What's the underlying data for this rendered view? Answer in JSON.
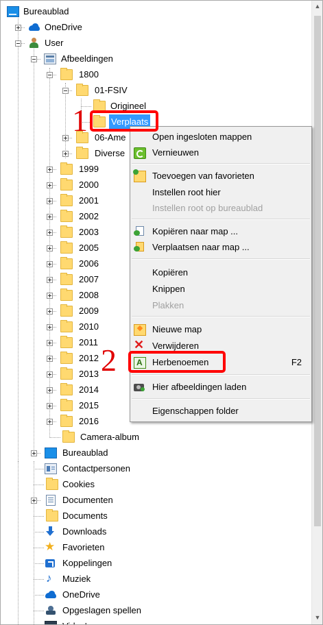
{
  "tree": {
    "root": "Bureaublad",
    "onedrive": "OneDrive",
    "user": "User",
    "afbeeldingen": "Afbeeldingen",
    "y1800": "1800",
    "fsiv": "01-FSIV",
    "origineel": "Origineel",
    "verplaatst": "Verplaats",
    "ame": "06-Ame",
    "diverse": "Diverse",
    "years": [
      "1999",
      "2000",
      "2001",
      "2002",
      "2003",
      "2005",
      "2006",
      "2007",
      "2008",
      "2009",
      "2010",
      "2011",
      "2012",
      "2013",
      "2014",
      "2015",
      "2016"
    ],
    "camera": "Camera-album",
    "user_children": [
      "Bureaublad",
      "Contactpersonen",
      "Cookies",
      "Documenten",
      "Documents",
      "Downloads",
      "Favorieten",
      "Koppelingen",
      "Muziek",
      "OneDrive",
      "Opgeslagen spellen",
      "Video's"
    ]
  },
  "menu": {
    "items": [
      {
        "label": "Open ingesloten mappen",
        "icon": "none"
      },
      {
        "label": "Vernieuwen",
        "icon": "refresh-icon"
      },
      {
        "label": "Toevoegen van favorieten",
        "icon": "add-favorite-icon"
      },
      {
        "label": "Instellen root hier",
        "icon": "none"
      },
      {
        "label": "Instellen root op bureaublad",
        "icon": "none",
        "disabled": true
      },
      {
        "label": "Kopiëren naar map ...",
        "icon": "copy-to-folder-icon"
      },
      {
        "label": "Verplaatsen naar map ...",
        "icon": "move-to-folder-icon"
      },
      {
        "label": "Kopiëren",
        "icon": "none"
      },
      {
        "label": "Knippen",
        "icon": "none"
      },
      {
        "label": "Plakken",
        "icon": "none",
        "disabled": true
      },
      {
        "label": "Nieuwe map",
        "icon": "new-folder-icon"
      },
      {
        "label": "Verwijderen",
        "icon": "delete-icon"
      },
      {
        "label": "Herbenoemen",
        "icon": "rename-icon",
        "shortcut": "F2"
      },
      {
        "label": "Hier afbeeldingen laden",
        "icon": "camera-icon"
      },
      {
        "label": "Eigenschappen folder",
        "icon": "none"
      }
    ]
  },
  "annotations": {
    "callout1": "1",
    "callout2": "2"
  },
  "colors": {
    "selection": "#3399ff",
    "callout": "#ff0000",
    "folder": "#ffd970"
  }
}
